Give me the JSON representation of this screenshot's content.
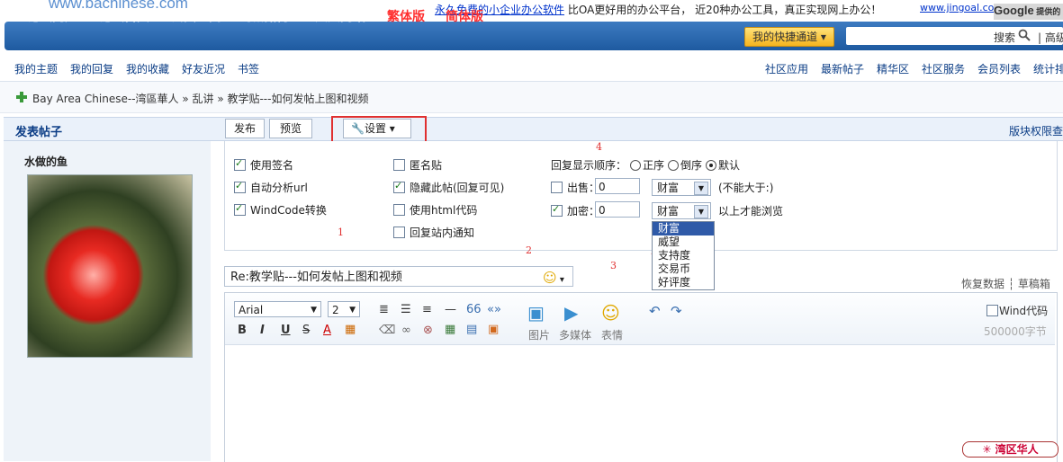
{
  "banner": {
    "logo": "www.bachinese.com",
    "ad_link": "永久免费的小企业办公软件",
    "ad_text": " 比OA更好用的办公平台， 近20种办公工具，真正实现网上办公！",
    "ad_url": "www.jingoal.co",
    "google": "Google",
    "google_small": " 提供的"
  },
  "nav": {
    "items": [
      "论坛门户",
      "论坛首页",
      "会员空间",
      "最新帖子",
      "六六网站",
      "繁体版",
      "简体版"
    ],
    "quick": "我的快捷通道",
    "search": "搜索",
    "advanced": "高级"
  },
  "subnav": {
    "left": [
      "我的主题",
      "我的回复",
      "我的收藏",
      "好友近况",
      "书签"
    ],
    "right": [
      "社区应用",
      "最新帖子",
      "精华区",
      "社区服务",
      "会员列表",
      "统计排"
    ]
  },
  "breadcrumb": "Bay Area Chinese--湾區華人 » 乱讲 » 教学贴---如何发帖上图和视频",
  "post": {
    "header": "发表帖子",
    "publish": "发布",
    "preview": "预览",
    "settings": "设置",
    "permissions": "版块权限查",
    "user": "水做的鱼"
  },
  "options": {
    "col1": [
      "使用签名",
      "自动分析url",
      "WindCode转换"
    ],
    "col2": [
      "匿名贴",
      "隐藏此帖(回复可见)",
      "使用html代码",
      "回复站内通知"
    ],
    "reply_order_label": "回复显示顺序：",
    "reply_order": [
      "正序",
      "倒序",
      "默认"
    ],
    "sell_label": "出售：",
    "sell_value": "0",
    "encrypt_label": "加密：",
    "encrypt_value": "0",
    "currency": "财富",
    "sell_note": "(不能大于:)",
    "encrypt_note": "以上才能浏览",
    "dropdown": [
      "财富",
      "威望",
      "支持度",
      "交易币",
      "好评度"
    ]
  },
  "annotations": [
    "1",
    "2",
    "3",
    "4"
  ],
  "title_input": "Re:教学贴---如何发帖上图和视频",
  "editor": {
    "font": "Arial",
    "size": "2",
    "labels": [
      "图片",
      "多媒体",
      "表情"
    ],
    "windcode": "Wind代码",
    "char_limit": "500000字节",
    "restore": "恢复数据",
    "drafts": "草稿箱"
  },
  "watermark": "✳ 湾区华人"
}
